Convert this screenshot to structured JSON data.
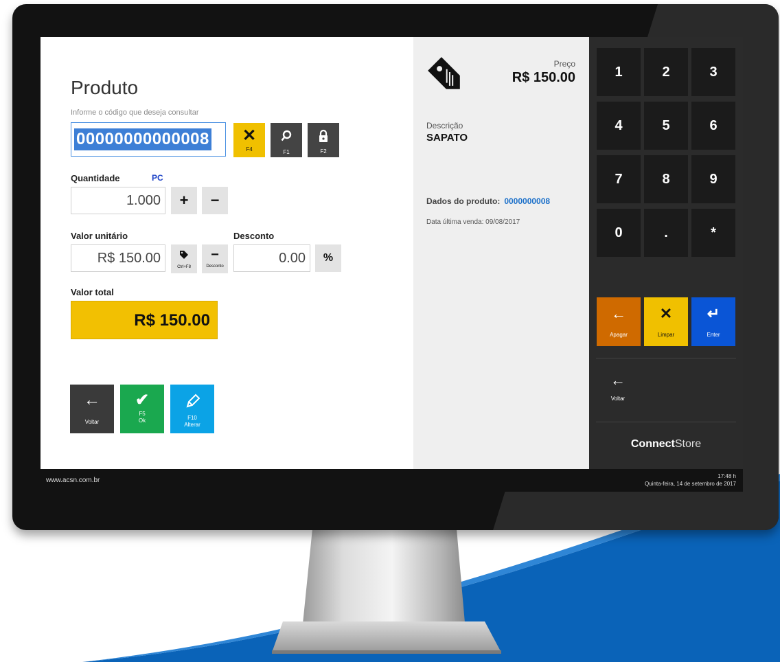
{
  "left": {
    "title": "Produto",
    "hint": "Informe o código que deseja consultar",
    "code_value": "00000000000008",
    "buttons": {
      "clear": {
        "key": "F4"
      },
      "search": {
        "key": "F1"
      },
      "lock": {
        "key": "F2"
      }
    },
    "quantity": {
      "label": "Quantidade",
      "unit": "PC",
      "value": "1.000",
      "plus": "+",
      "minus": "−"
    },
    "unit_value": {
      "label": "Valor unitário",
      "value": "R$ 150.00",
      "tag_key": "Ctrl+F8",
      "discount_key": "Desconto"
    },
    "discount": {
      "label": "Desconto",
      "value": "0.00",
      "percent": "%"
    },
    "total": {
      "label": "Valor total",
      "value": "R$ 150.00"
    },
    "actions": [
      {
        "label": "Voltar",
        "key": "",
        "color": "#3a3a3a"
      },
      {
        "label": "Ok",
        "key": "F5",
        "color": "#1aa84f"
      },
      {
        "label": "Alterar",
        "key": "F10",
        "color": "#0ba3e6"
      }
    ]
  },
  "middle": {
    "price_label": "Preço",
    "price_value": "R$ 150.00",
    "description_label": "Descrição",
    "description_value": "SAPATO",
    "product_data_label": "Dados do produto:",
    "product_data_value": "0000000008",
    "last_sale": "Data última venda: 09/08/2017"
  },
  "keypad": {
    "keys": [
      "1",
      "2",
      "3",
      "4",
      "5",
      "6",
      "7",
      "8",
      "9",
      "0",
      ".",
      "*"
    ],
    "functions": [
      {
        "label": "Apagar",
        "color": "#cf6a00"
      },
      {
        "label": "Limpar",
        "color": "#f0c000"
      },
      {
        "label": "Enter",
        "color": "#0a55d6"
      }
    ],
    "back_label": "Voltar",
    "brand_bold": "Connect",
    "brand_light": "Store"
  },
  "status": {
    "site": "www.acsn.com.br",
    "time": "17:48 h",
    "date": "Quinta-feira, 14 de setembro de 2017"
  }
}
